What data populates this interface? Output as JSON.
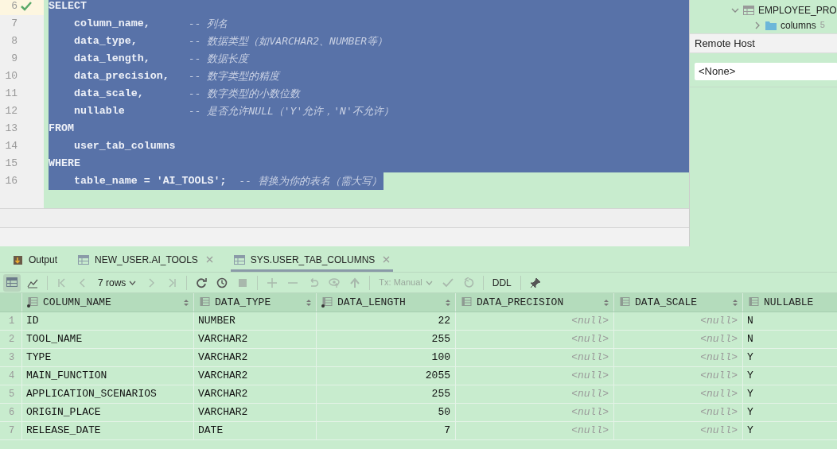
{
  "editor": {
    "lines": [
      {
        "number": "6",
        "code": "SELECT",
        "current": true,
        "selected": true
      },
      {
        "number": "7",
        "code": "    column_name,",
        "comment": "-- 列名",
        "current": false,
        "selected": true
      },
      {
        "number": "8",
        "code": "    data_type,",
        "comment": "-- 数据类型（如VARCHAR2、NUMBER等）",
        "current": false,
        "selected": true
      },
      {
        "number": "9",
        "code": "    data_length,",
        "comment": "-- 数据长度",
        "current": false,
        "selected": true
      },
      {
        "number": "10",
        "code": "    data_precision,",
        "comment": "-- 数字类型的精度",
        "current": false,
        "selected": true
      },
      {
        "number": "11",
        "code": "    data_scale,",
        "comment": "-- 数字类型的小数位数",
        "current": false,
        "selected": true
      },
      {
        "number": "12",
        "code": "    nullable",
        "comment": "-- 是否允许NULL（'Y'允许，'N'不允许）",
        "current": false,
        "selected": true
      },
      {
        "number": "13",
        "code": "FROM",
        "current": false,
        "selected": true
      },
      {
        "number": "14",
        "code": "    user_tab_columns",
        "current": false,
        "selected": true
      },
      {
        "number": "15",
        "code": "WHERE",
        "current": false,
        "selected": true
      },
      {
        "number": "16",
        "code": "    table_name = 'AI_TOOLS';",
        "comment": "-- 替换为你的表名（需大写）",
        "current": false,
        "selected": true
      }
    ]
  },
  "tree": {
    "items": [
      {
        "label": "EMPLOYEE_PRO",
        "kind": "table",
        "expanded": true
      },
      {
        "label": "columns",
        "count": "5",
        "kind": "folder",
        "expanded": false
      }
    ]
  },
  "remote_host": {
    "title": "Remote Host",
    "value": "<None>"
  },
  "tabs": [
    {
      "label": "Output",
      "kind": "output",
      "closable": false,
      "selected": false
    },
    {
      "label": "NEW_USER.AI_TOOLS",
      "kind": "table",
      "closable": true,
      "selected": false
    },
    {
      "label": "SYS.USER_TAB_COLUMNS",
      "kind": "table",
      "closable": true,
      "selected": true
    }
  ],
  "toolbar": {
    "rows": "7 rows",
    "tx": "Tx: Manual",
    "ddl": "DDL"
  },
  "table": {
    "columns": [
      {
        "label": "COLUMN_NAME",
        "key": true
      },
      {
        "label": "DATA_TYPE",
        "key": false
      },
      {
        "label": "DATA_LENGTH",
        "key": true
      },
      {
        "label": "DATA_PRECISION",
        "key": false
      },
      {
        "label": "DATA_SCALE",
        "key": false
      },
      {
        "label": "NULLABLE",
        "key": false
      }
    ],
    "rows": [
      {
        "number": "1",
        "cells": [
          {
            "text": "ID",
            "kind": "text"
          },
          {
            "text": "NUMBER",
            "kind": "text"
          },
          {
            "text": "22",
            "kind": "number"
          },
          {
            "text": "<null>",
            "kind": "null"
          },
          {
            "text": "<null>",
            "kind": "null"
          },
          {
            "text": "N",
            "kind": "text"
          }
        ]
      },
      {
        "number": "2",
        "cells": [
          {
            "text": "TOOL_NAME",
            "kind": "text"
          },
          {
            "text": "VARCHAR2",
            "kind": "text"
          },
          {
            "text": "255",
            "kind": "number"
          },
          {
            "text": "<null>",
            "kind": "null"
          },
          {
            "text": "<null>",
            "kind": "null"
          },
          {
            "text": "N",
            "kind": "text"
          }
        ]
      },
      {
        "number": "3",
        "cells": [
          {
            "text": "TYPE",
            "kind": "text"
          },
          {
            "text": "VARCHAR2",
            "kind": "text"
          },
          {
            "text": "100",
            "kind": "number"
          },
          {
            "text": "<null>",
            "kind": "null"
          },
          {
            "text": "<null>",
            "kind": "null"
          },
          {
            "text": "Y",
            "kind": "text"
          }
        ]
      },
      {
        "number": "4",
        "cells": [
          {
            "text": "MAIN_FUNCTION",
            "kind": "text"
          },
          {
            "text": "VARCHAR2",
            "kind": "text"
          },
          {
            "text": "2055",
            "kind": "number"
          },
          {
            "text": "<null>",
            "kind": "null"
          },
          {
            "text": "<null>",
            "kind": "null"
          },
          {
            "text": "Y",
            "kind": "text"
          }
        ]
      },
      {
        "number": "5",
        "cells": [
          {
            "text": "APPLICATION_SCENARIOS",
            "kind": "text"
          },
          {
            "text": "VARCHAR2",
            "kind": "text"
          },
          {
            "text": "255",
            "kind": "number"
          },
          {
            "text": "<null>",
            "kind": "null"
          },
          {
            "text": "<null>",
            "kind": "null"
          },
          {
            "text": "Y",
            "kind": "text"
          }
        ]
      },
      {
        "number": "6",
        "cells": [
          {
            "text": "ORIGIN_PLACE",
            "kind": "text"
          },
          {
            "text": "VARCHAR2",
            "kind": "text"
          },
          {
            "text": "50",
            "kind": "number"
          },
          {
            "text": "<null>",
            "kind": "null"
          },
          {
            "text": "<null>",
            "kind": "null"
          },
          {
            "text": "Y",
            "kind": "text"
          }
        ]
      },
      {
        "number": "7",
        "cells": [
          {
            "text": "RELEASE_DATE",
            "kind": "text"
          },
          {
            "text": "DATE",
            "kind": "text"
          },
          {
            "text": "7",
            "kind": "number"
          },
          {
            "text": "<null>",
            "kind": "null"
          },
          {
            "text": "<null>",
            "kind": "null"
          },
          {
            "text": "Y",
            "kind": "text"
          }
        ]
      }
    ]
  }
}
